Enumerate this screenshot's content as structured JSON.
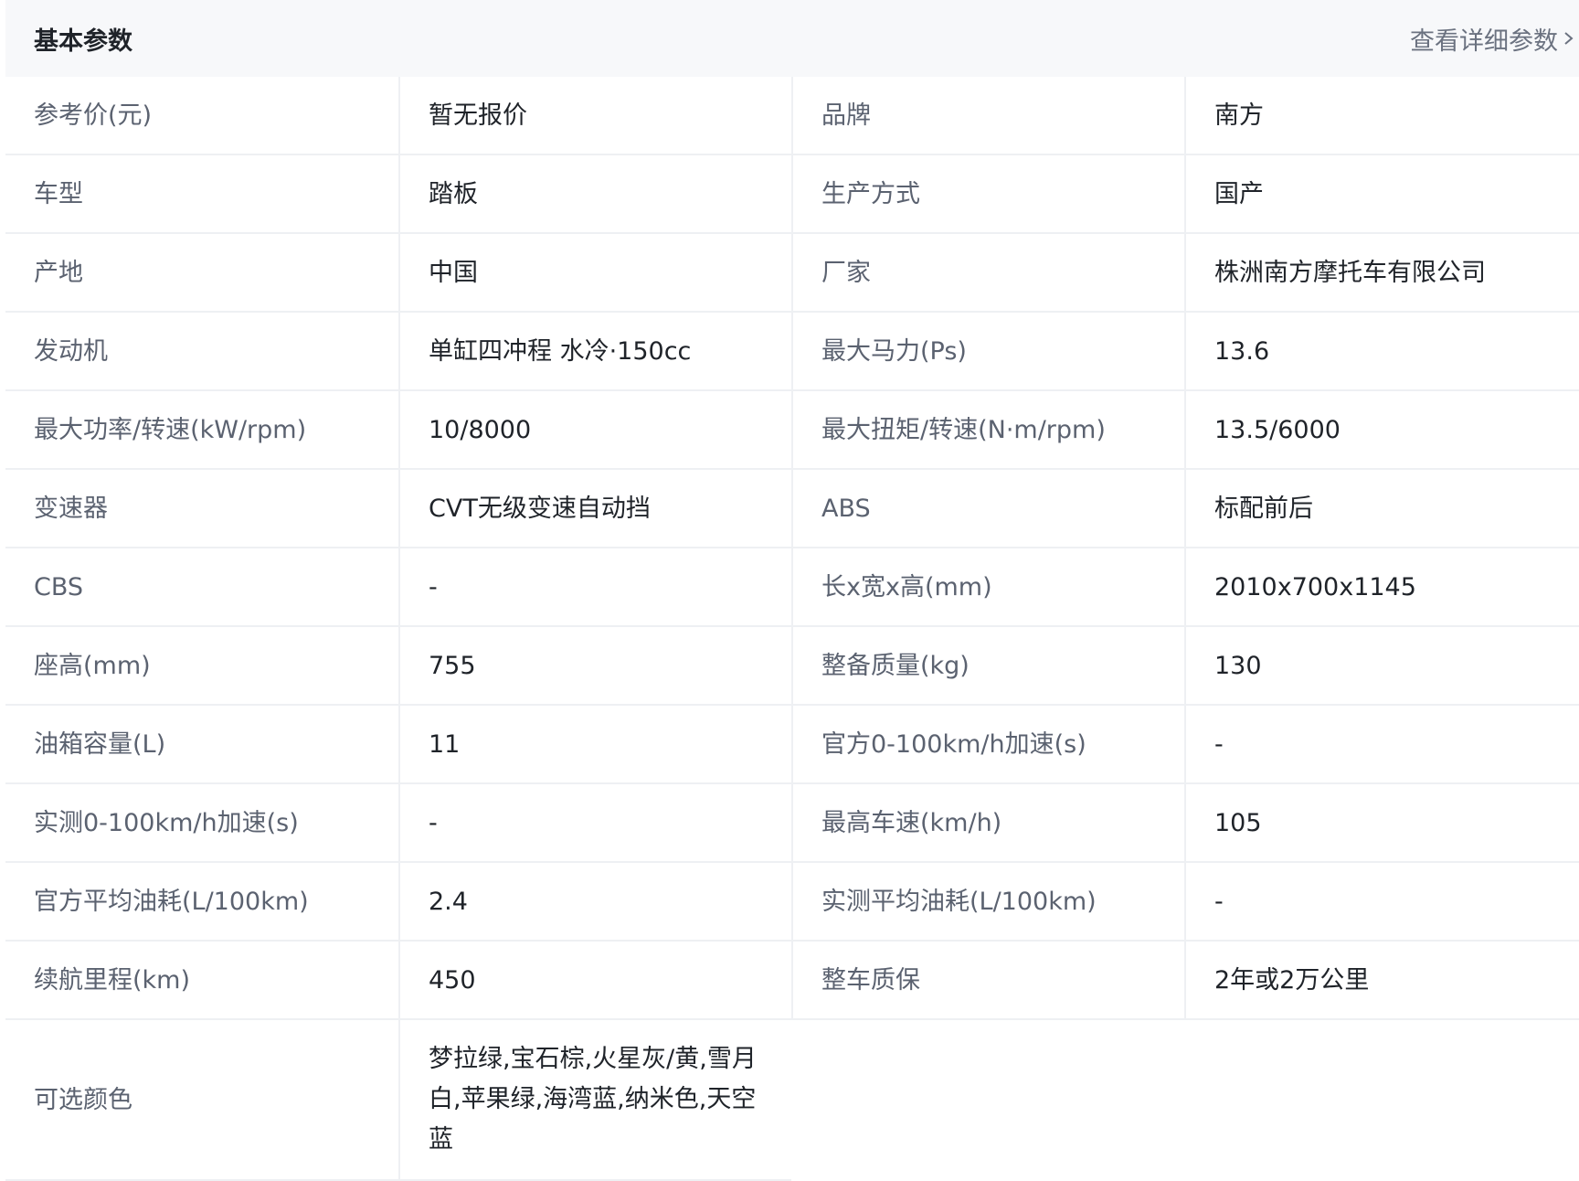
{
  "header": {
    "title": "基本参数",
    "detail_link": "查看详细参数",
    "chevron_icon": "chevron-right-icon"
  },
  "rows": [
    {
      "l1": "参考价(元)",
      "v1": "暂无报价",
      "l2": "品牌",
      "v2": "南方"
    },
    {
      "l1": "车型",
      "v1": "踏板",
      "l2": "生产方式",
      "v2": "国产"
    },
    {
      "l1": "产地",
      "v1": "中国",
      "l2": "厂家",
      "v2": "株洲南方摩托车有限公司"
    },
    {
      "l1": "发动机",
      "v1": "单缸四冲程 水冷·150cc",
      "l2": "最大马力(Ps)",
      "v2": "13.6"
    },
    {
      "l1": "最大功率/转速(kW/rpm)",
      "v1": "10/8000",
      "l2": "最大扭矩/转速(N·m/rpm)",
      "v2": "13.5/6000"
    },
    {
      "l1": "变速器",
      "v1": "CVT无级变速自动挡",
      "l2": "ABS",
      "v2": "标配前后"
    },
    {
      "l1": "CBS",
      "v1": "-",
      "l2": "长x宽x高(mm)",
      "v2": "2010x700x1145"
    },
    {
      "l1": "座高(mm)",
      "v1": "755",
      "l2": "整备质量(kg)",
      "v2": "130"
    },
    {
      "l1": "油箱容量(L)",
      "v1": "11",
      "l2": "官方0-100km/h加速(s)",
      "v2": "-"
    },
    {
      "l1": "实测0-100km/h加速(s)",
      "v1": "-",
      "l2": "最高车速(km/h)",
      "v2": "105"
    },
    {
      "l1": "官方平均油耗(L/100km)",
      "v1": "2.4",
      "l2": "实测平均油耗(L/100km)",
      "v2": "-"
    },
    {
      "l1": "续航里程(km)",
      "v1": "450",
      "l2": "整车质保",
      "v2": "2年或2万公里"
    }
  ],
  "last_row": {
    "label": "可选颜色",
    "value": "梦拉绿,宝石棕,火星灰/黄,雪月白,苹果绿,海湾蓝,纳米色,天空蓝"
  },
  "colors": {
    "header_bg": "#f7f8fa",
    "label_text": "#5b6270",
    "value_text": "#1f2329",
    "border": "#eef0f3",
    "link_text": "#6b7280"
  }
}
